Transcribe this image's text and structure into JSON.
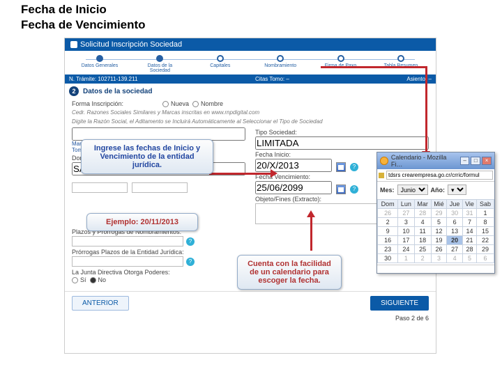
{
  "slide": {
    "title": "Fecha de Inicio",
    "subtitle": "Fecha de Vencimiento"
  },
  "header": {
    "title": "Solicitud Inscripción Sociedad"
  },
  "steps": [
    {
      "label": "Datos Generales",
      "done": true
    },
    {
      "label": "Datos de la Sociedad",
      "done": true
    },
    {
      "label": "Capitales",
      "done": false
    },
    {
      "label": "Nombramiento",
      "done": false
    },
    {
      "label": "Firma de Paxo",
      "done": false
    },
    {
      "label": "Tabla Resumen",
      "done": false
    }
  ],
  "stepbar": {
    "left": "N. Trámite: 102711-139.211",
    "mid": "Citas  Tomo: –",
    "right": "Asiento: –"
  },
  "section": {
    "num": "2",
    "title": "Datos de la sociedad"
  },
  "form": {
    "forma_label": "Forma Inscripción:",
    "forma_opts": [
      "Nueva",
      "Nombre"
    ],
    "cedr_note": "Cedr. Razones Sociales Similares y Marcas inscritas en www.rnpdigital.com",
    "digite_note": "Digite la Razón Social, el Aditamento se Incluirá Automáticamente al Seleccionar el Tipo de Sociedad",
    "tipo_label": "Tipo Sociedad:",
    "tipo_value": "LIMITADA",
    "marca_label": "Marca Registrada",
    "marca_value": "Tomo 378 Asiento 20",
    "domicilio_label": "Domicilio:",
    "domicilio_value": "SAN JOSE ASEREI",
    "fecha_inicio_label": "Fecha Inicio:",
    "fecha_inicio_value": "20/X/2013",
    "fecha_venc_label": "Fecha Vencimiento:",
    "fecha_venc_value": "25/06/2099",
    "objeto_label": "Objeto/Fines (Extracto):",
    "plazos_label": "Plazos y Prórrogas de Nombramientos:",
    "prorrogas_label": "Prórrogas Plazos de la Entidad Jurídica:",
    "poderes_label": "La Junta Directiva Otorga Poderes:",
    "poderes_opts": [
      "Sí",
      "No"
    ]
  },
  "buttons": {
    "prev": "ANTERIOR",
    "next": "SIGUIENTE"
  },
  "paso": "Paso 2 de 6",
  "callouts": {
    "c1": "Ingrese las fechas de Inicio y Vencimiento de la entidad jurídica.",
    "c2": "Ejemplo: 20/11/2013",
    "c3": "Cuenta con la facilidad de un calendario para escoger la fecha."
  },
  "popup": {
    "title": "Calendario - Mozilla Fi…",
    "url": "tdsrs crearempresa.go.cr/crric/formul",
    "mes_label": "Mes:",
    "mes_value": "Junio",
    "ano_label": "Año:",
    "ano_value": "▾",
    "days": [
      "Dom",
      "Lun",
      "Mar",
      "Mié",
      "Jue",
      "Vie",
      "Sab"
    ],
    "weeks": [
      [
        "26",
        "27",
        "28",
        "29",
        "30",
        "31",
        "1"
      ],
      [
        "2",
        "3",
        "4",
        "5",
        "6",
        "7",
        "8"
      ],
      [
        "9",
        "10",
        "11",
        "12",
        "13",
        "14",
        "15"
      ],
      [
        "16",
        "17",
        "18",
        "19",
        "20",
        "21",
        "22"
      ],
      [
        "23",
        "24",
        "25",
        "26",
        "27",
        "28",
        "29"
      ],
      [
        "30",
        "1",
        "2",
        "3",
        "4",
        "5",
        "6"
      ]
    ],
    "dim_first": 6,
    "dim_last_start": 1,
    "today": "20"
  }
}
